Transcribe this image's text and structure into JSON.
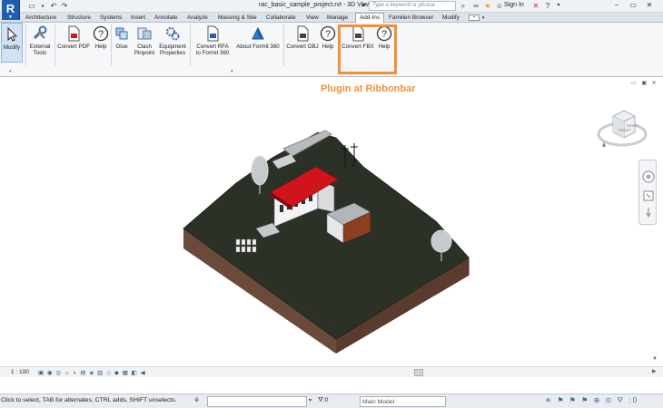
{
  "titlebar": {
    "app_logo": "R",
    "doc_title": "rac_basic_sample_project.rvt - 3D View...",
    "search_placeholder": "Type a keyword or phrase",
    "user": "Sign In",
    "icons": [
      "search-icon",
      "binoculars-icon",
      "star-icon",
      "user-icon",
      "exchange-icon",
      "help-icon",
      "minimize-icon",
      "restore-icon",
      "close-icon"
    ]
  },
  "tabs": [
    "Architecture",
    "Structure",
    "Systems",
    "Insert",
    "Annotate",
    "Analyze",
    "Massing & Site",
    "Collaborate",
    "View",
    "Manage",
    "Add-Ins",
    "Familien Browser",
    "Modify"
  ],
  "active_tab": "Add-Ins",
  "ribbon": {
    "modify": "Modify",
    "external_tools_1": "External",
    "external_tools_2": "Tools",
    "convert_pdf": "Convert PDF",
    "help1": "Help",
    "glue": "Glue",
    "clash_1": "Clash",
    "clash_2": "Pinpoint",
    "equip_1": "Equipment",
    "equip_2": "Properties",
    "rfa_1": "Convert RFA",
    "rfa_2": "to Formit 360",
    "about_formit": "About Formit 360",
    "convert_obj": "Convert OBJ",
    "help2": "Help",
    "convert_fbx": "Convert FBX",
    "help3": "Help"
  },
  "annotation": "Plugin at Ribbonbar",
  "view_control_bar": {
    "scale": "1 : 100"
  },
  "status": {
    "text": "Click to select, TAB for alternates, CTRL adds, SHIFT unselects.",
    "count": ":0",
    "model": "Main Model"
  },
  "colors": {
    "highlight": "#f0913a",
    "roof": "#d0141c",
    "terrain_top": "#2c3127",
    "terrain_side": "#6b4a3a"
  }
}
